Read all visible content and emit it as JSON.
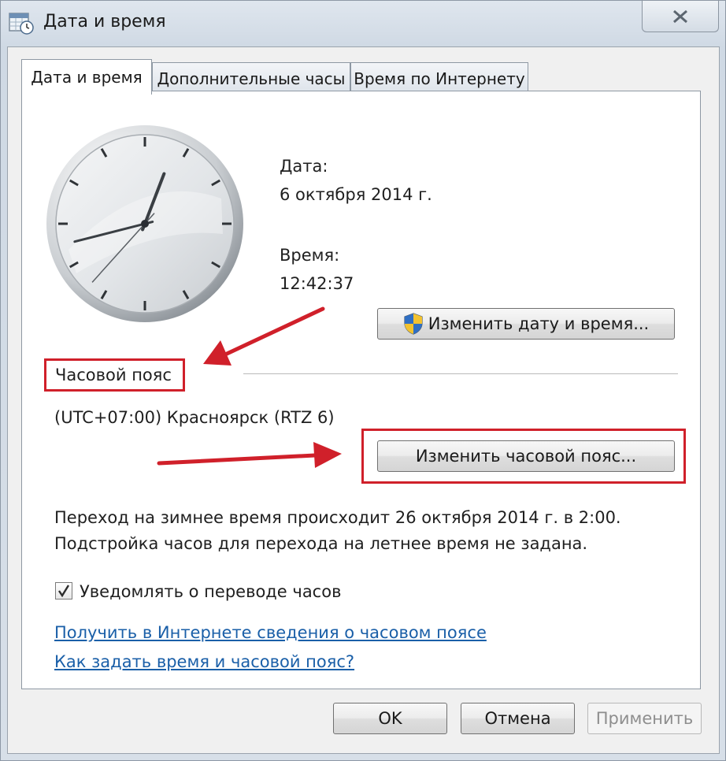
{
  "window": {
    "title": "Дата и время",
    "close_symbol": "✕"
  },
  "tabs": [
    {
      "label": "Дата и время",
      "active": true
    },
    {
      "label": "Дополнительные часы",
      "active": false
    },
    {
      "label": "Время по Интернету",
      "active": false
    }
  ],
  "datetime": {
    "date_label": "Дата:",
    "date_value": "6 октября 2014 г.",
    "time_label": "Время:",
    "time_value": "12:42:37",
    "change_button": "Изменить дату и время..."
  },
  "timezone": {
    "section_label": "Часовой пояс",
    "value": "(UTC+07:00) Красноярск (RTZ 6)",
    "change_button": "Изменить часовой пояс..."
  },
  "dst_info": {
    "line1": "Переход на зимнее время происходит 26 октября 2014 г. в 2:00.",
    "line2": "Подстройка часов для перехода на летнее время не задана."
  },
  "notify": {
    "label": "Уведомлять о переводе часов",
    "checked": true
  },
  "links": {
    "online_info": "Получить в Интернете сведения о часовом поясе",
    "how_to": "Как задать время и часовой пояс?"
  },
  "footer": {
    "ok": "OK",
    "cancel": "Отмена",
    "apply": "Применить"
  },
  "clock": {
    "hours": 12,
    "minutes": 42,
    "seconds": 37
  },
  "colors": {
    "highlight": "#d0202a",
    "link": "#1a5fa8",
    "arrow": "#d0202a"
  },
  "icons": [
    "calendar-clock-icon",
    "close-icon",
    "uac-shield-icon",
    "checkmark-icon"
  ]
}
